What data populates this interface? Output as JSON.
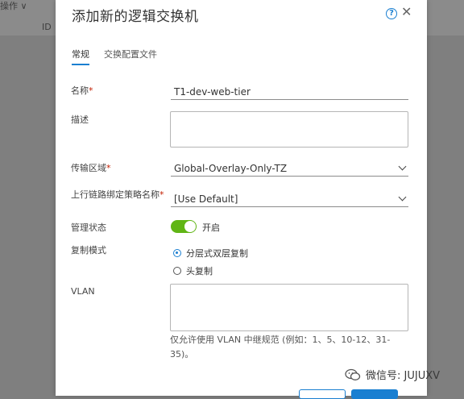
{
  "background": {
    "action_label": "操作 ∨",
    "id_header": "ID"
  },
  "dialog": {
    "title": "添加新的逻辑交换机",
    "help_icon": "question-circle-icon",
    "close_icon": "close-icon",
    "tabs": [
      {
        "label": "常规",
        "active": true
      },
      {
        "label": "交换配置文件",
        "active": false
      }
    ],
    "fields": {
      "name": {
        "label": "名称",
        "required_mark": "*",
        "value": "T1-dev-web-tier"
      },
      "description": {
        "label": "描述",
        "value": ""
      },
      "transport_zone": {
        "label": "传输区域",
        "required_mark": "*",
        "value": "Global-Overlay-Only-TZ"
      },
      "uplink_policy": {
        "label": "上行链路绑定策略名称",
        "required_mark": "*",
        "value": "[Use Default]"
      },
      "admin_state": {
        "label": "管理状态",
        "value": "开启",
        "on": true
      },
      "replication_mode": {
        "label": "复制模式",
        "options": [
          {
            "label": "分层式双层复制",
            "selected": true
          },
          {
            "label": "头复制",
            "selected": false
          }
        ]
      },
      "vlan": {
        "label": "VLAN",
        "value": "",
        "hint": "仅允许使用 VLAN 中继规范 (例如：1、5、10-12、31-35)。"
      }
    }
  },
  "watermark": {
    "text": "微信号: JUJUXV"
  },
  "colors": {
    "accent": "#1a7fd1",
    "toggle_on": "#60b515",
    "required": "#c21d00"
  }
}
